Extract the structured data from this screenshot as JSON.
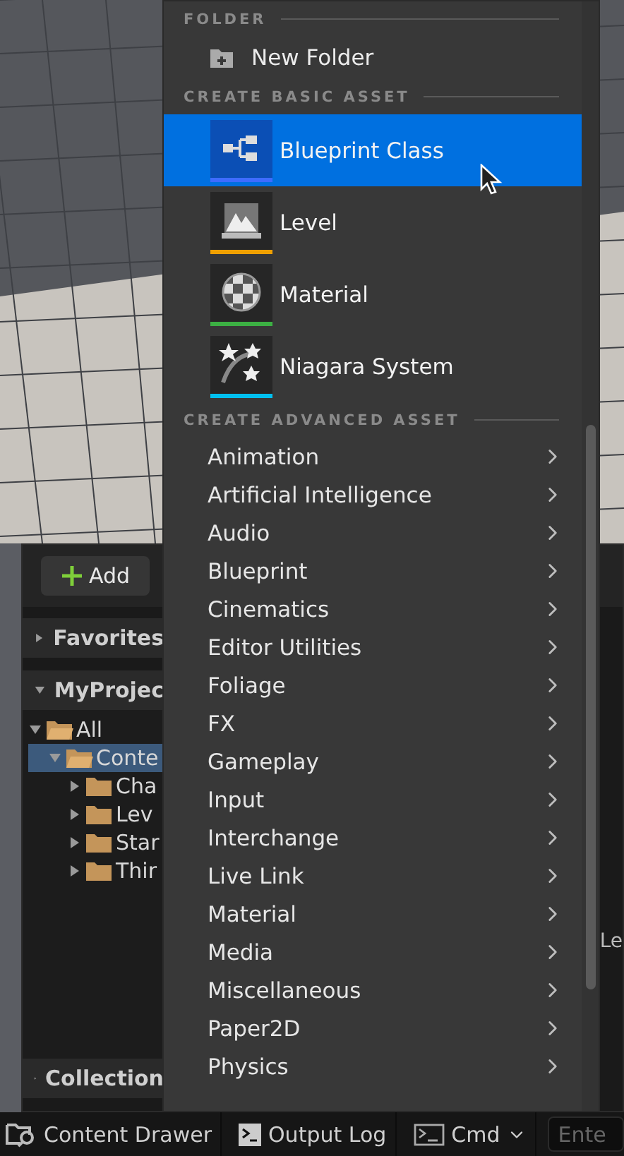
{
  "content_browser": {
    "add_button": "Add",
    "sources": [
      {
        "label": "Favorites",
        "expanded": false
      },
      {
        "label": "MyProjec",
        "expanded": true
      }
    ],
    "tree": [
      {
        "label": "All",
        "expanded": true,
        "selected": false,
        "children": [
          {
            "label": "Conte",
            "expanded": true,
            "selected": true,
            "children": [
              {
                "label": "Cha",
                "expanded": false,
                "selected": false
              },
              {
                "label": "Lev",
                "expanded": false,
                "selected": false
              },
              {
                "label": "Star",
                "expanded": false,
                "selected": false
              },
              {
                "label": "Thir",
                "expanded": false,
                "selected": false
              }
            ]
          }
        ]
      }
    ],
    "collections": {
      "label": "Collection",
      "expanded": false
    },
    "side_text": "Le"
  },
  "menu": {
    "sections": [
      {
        "title": "FOLDER",
        "items": [
          {
            "kind": "folder",
            "label": "New Folder",
            "selected": false
          }
        ]
      },
      {
        "title": "CREATE BASIC ASSET",
        "items": [
          {
            "kind": "asset",
            "label": "Blueprint Class",
            "color": "#3d6cff",
            "selected": true
          },
          {
            "kind": "asset",
            "label": "Level",
            "color": "#f0a000",
            "selected": false
          },
          {
            "kind": "asset",
            "label": "Material",
            "color": "#3cb043",
            "selected": false
          },
          {
            "kind": "asset",
            "label": "Niagara System",
            "color": "#00c0f0",
            "selected": false
          }
        ]
      },
      {
        "title": "CREATE ADVANCED ASSET",
        "items": [
          {
            "kind": "submenu",
            "label": "Animation",
            "selected": false
          },
          {
            "kind": "submenu",
            "label": "Artificial Intelligence",
            "selected": false
          },
          {
            "kind": "submenu",
            "label": "Audio",
            "selected": false
          },
          {
            "kind": "submenu",
            "label": "Blueprint",
            "selected": false
          },
          {
            "kind": "submenu",
            "label": "Cinematics",
            "selected": false
          },
          {
            "kind": "submenu",
            "label": "Editor Utilities",
            "selected": false
          },
          {
            "kind": "submenu",
            "label": "Foliage",
            "selected": false
          },
          {
            "kind": "submenu",
            "label": "FX",
            "selected": false
          },
          {
            "kind": "submenu",
            "label": "Gameplay",
            "selected": false
          },
          {
            "kind": "submenu",
            "label": "Input",
            "selected": false
          },
          {
            "kind": "submenu",
            "label": "Interchange",
            "selected": false
          },
          {
            "kind": "submenu",
            "label": "Live Link",
            "selected": false
          },
          {
            "kind": "submenu",
            "label": "Material",
            "selected": false
          },
          {
            "kind": "submenu",
            "label": "Media",
            "selected": false
          },
          {
            "kind": "submenu",
            "label": "Miscellaneous",
            "selected": false
          },
          {
            "kind": "submenu",
            "label": "Paper2D",
            "selected": false
          },
          {
            "kind": "submenu",
            "label": "Physics",
            "selected": false
          }
        ]
      }
    ]
  },
  "status_bar": {
    "items": [
      {
        "kind": "drawer",
        "label": "Content Drawer"
      },
      {
        "kind": "log",
        "label": "Output Log"
      },
      {
        "kind": "cmd",
        "label": "Cmd"
      }
    ],
    "console": {
      "placeholder": "Ente"
    }
  }
}
